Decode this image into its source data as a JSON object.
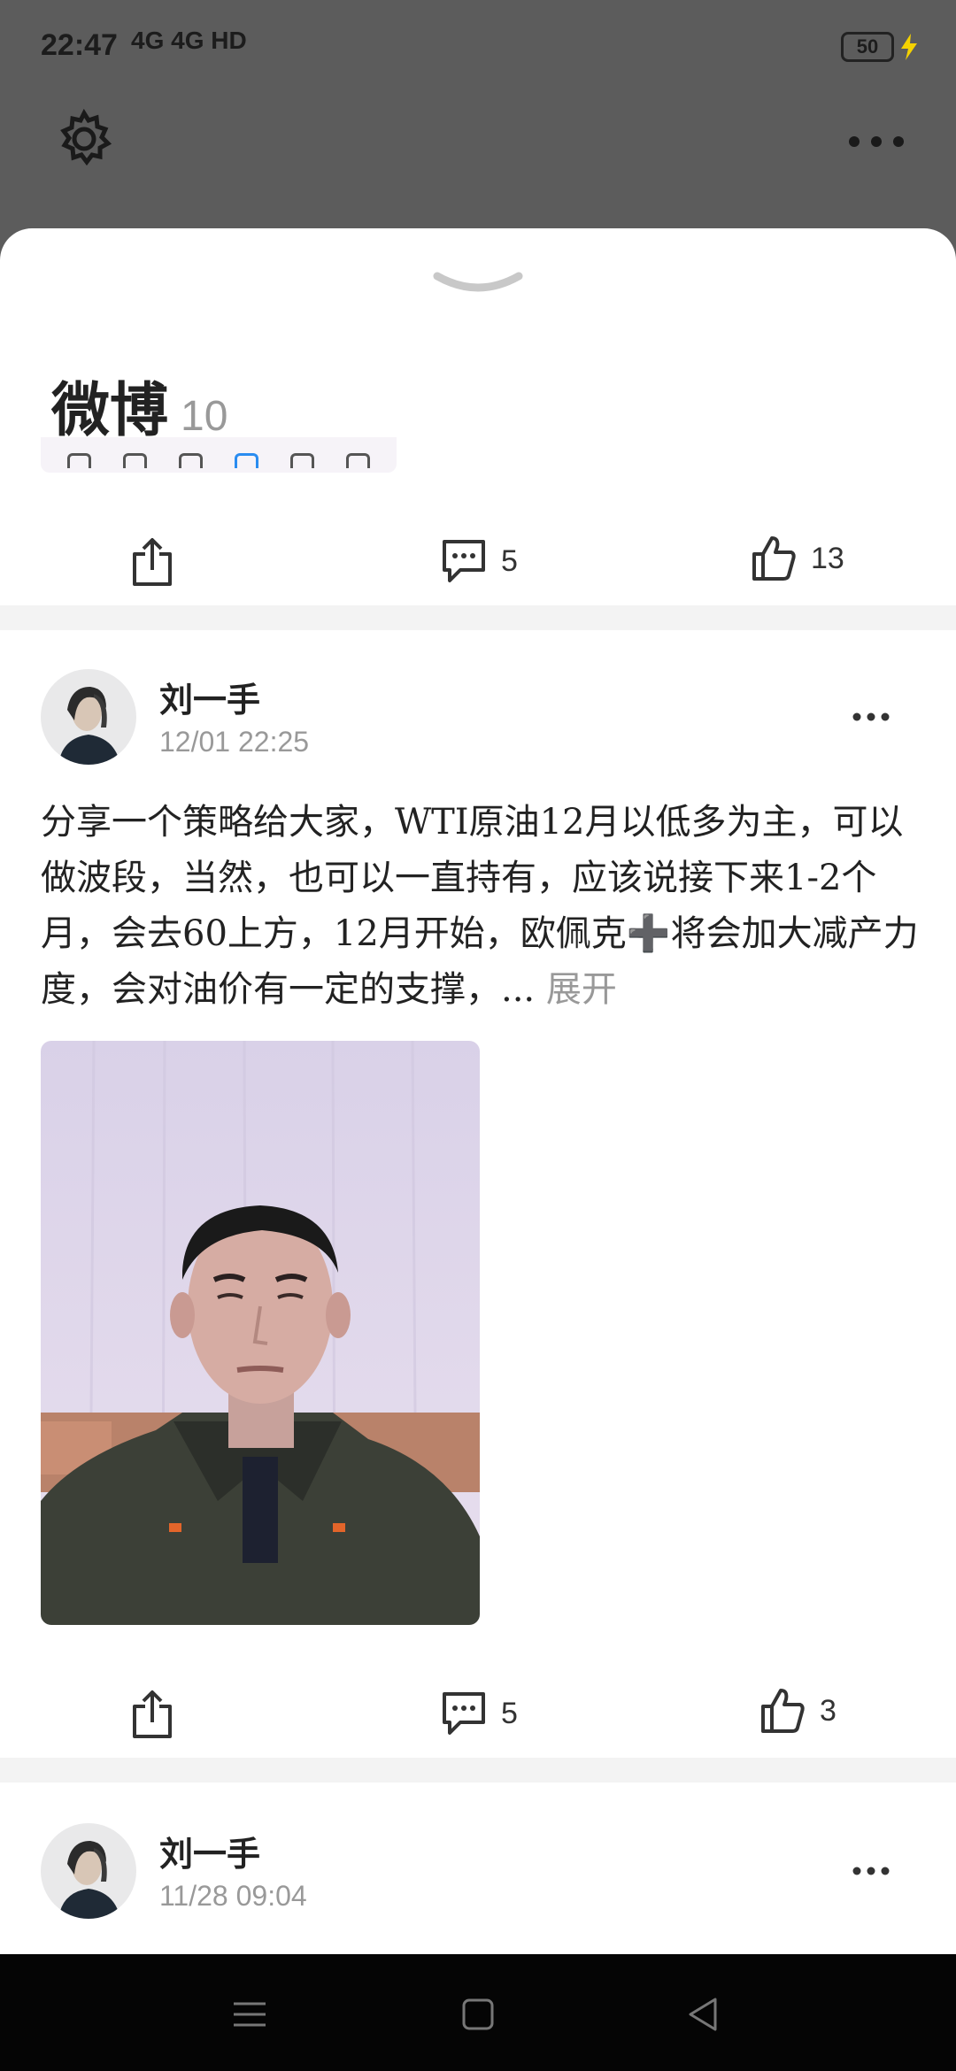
{
  "status_bar": {
    "time": "22:47",
    "network": "4G 4G HD",
    "battery": "50",
    "charging_color": "#f5d200"
  },
  "header": {
    "settings_icon": "gear-icon",
    "more_icon": "more-horizontal-icon"
  },
  "sheet": {
    "collapse_icon": "chevron-down-icon",
    "title": "微博",
    "count": "10"
  },
  "post_prev": {
    "actions": {
      "share_icon": "share-icon",
      "comments": "5",
      "likes": "13"
    }
  },
  "post1": {
    "author": "刘一手",
    "time": "12/01 22:25",
    "text": "分享一个策略给大家，WTI原油12月以低多为主，可以做波段，当然，也可以一直持有，应该说接下来1-2个月，会去60上方，12月开始，欧佩克➕将会加大减产力度，会对油价有一定的支撑，...",
    "expand": "展开",
    "photo": "selfie-photo",
    "actions": {
      "share_icon": "share-icon",
      "comments": "5",
      "likes": "3"
    }
  },
  "post2": {
    "author": "刘一手",
    "time": "11/28 09:04"
  },
  "nav": {
    "menu_icon": "menu-icon",
    "home_icon": "square-home-icon",
    "back_icon": "triangle-back-icon"
  }
}
